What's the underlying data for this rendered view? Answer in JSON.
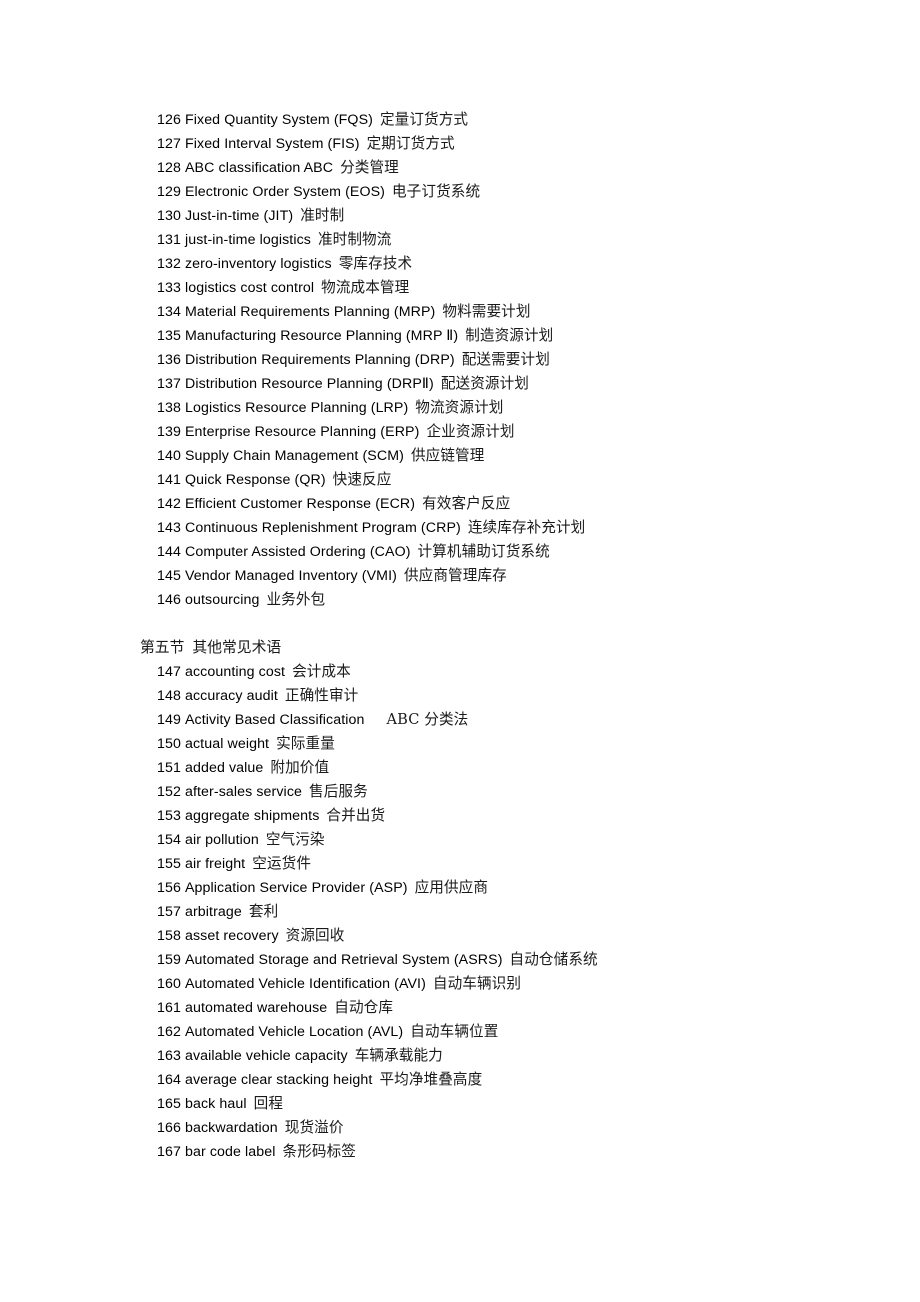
{
  "document": {
    "page_background": "#ffffff",
    "text_color": "#000000",
    "blocks": [
      {
        "type": "entry-list",
        "entries": [
          {
            "num": "126",
            "term": "Fixed Quantity System (FQS)",
            "gloss": "定量订货方式"
          },
          {
            "num": "127",
            "term": "Fixed Interval System (FIS)",
            "gloss": "定期订货方式"
          },
          {
            "num": "128",
            "term": "ABC classification ABC",
            "gloss": "分类管理"
          },
          {
            "num": "129",
            "term": "Electronic Order System (EOS)",
            "gloss": "电子订货系统"
          },
          {
            "num": "130",
            "term": "Just-in-time (JIT)",
            "gloss": "准时制"
          },
          {
            "num": "131",
            "term": "just-in-time logistics",
            "gloss": "准时制物流"
          },
          {
            "num": "132",
            "term": "zero-inventory logistics",
            "gloss": "零库存技术"
          },
          {
            "num": "133",
            "term": "logistics cost control",
            "gloss": "物流成本管理"
          },
          {
            "num": "134",
            "term": "Material Requirements Planning (MRP)",
            "gloss": "物料需要计划"
          },
          {
            "num": "135",
            "term": "Manufacturing Resource Planning (MRP Ⅱ)",
            "gloss": "制造资源计划"
          },
          {
            "num": "136",
            "term": "Distribution Requirements Planning (DRP)",
            "gloss": "配送需要计划"
          },
          {
            "num": "137",
            "term": "Distribution Resource Planning (DRPⅡ)",
            "gloss": "配送资源计划"
          },
          {
            "num": "138",
            "term": "Logistics Resource Planning (LRP)",
            "gloss": "物流资源计划"
          },
          {
            "num": "139",
            "term": "Enterprise Resource Planning (ERP)",
            "gloss": "企业资源计划"
          },
          {
            "num": "140",
            "term": "Supply Chain Management (SCM)",
            "gloss": "供应链管理"
          },
          {
            "num": "141",
            "term": "Quick Response (QR)",
            "gloss": "快速反应"
          },
          {
            "num": "142",
            "term": "Efficient Customer Response (ECR)",
            "gloss": "有效客户反应"
          },
          {
            "num": "143",
            "term": "Continuous Replenishment Program (CRP)",
            "gloss": "连续库存补充计划"
          },
          {
            "num": "144",
            "term": "Computer Assisted Ordering (CAO)",
            "gloss": "计算机辅助订货系统"
          },
          {
            "num": "145",
            "term": "Vendor Managed Inventory (VMI)",
            "gloss": "供应商管理库存"
          },
          {
            "num": "146",
            "term": "outsourcing",
            "gloss": "业务外包"
          }
        ]
      },
      {
        "type": "section-heading",
        "label": "第五节",
        "title": "其他常见术语"
      },
      {
        "type": "entry-list",
        "entries": [
          {
            "num": "147",
            "term": "accounting cost",
            "gloss": "会计成本"
          },
          {
            "num": "148",
            "term": "accuracy audit",
            "gloss": "正确性审计"
          },
          {
            "num": "149",
            "term": "Activity Based Classification",
            "gloss": "ABC 分类法",
            "gap": "wide"
          },
          {
            "num": "150",
            "term": "actual weight",
            "gloss": "实际重量"
          },
          {
            "num": "151",
            "term": "added value",
            "gloss": "附加价值"
          },
          {
            "num": "152",
            "term": "after-sales service",
            "gloss": "售后服务"
          },
          {
            "num": "153",
            "term": "aggregate shipments",
            "gloss": "合并出货"
          },
          {
            "num": "154",
            "term": "air pollution",
            "gloss": "空气污染"
          },
          {
            "num": "155",
            "term": "air freight",
            "gloss": "空运货件"
          },
          {
            "num": "156",
            "term": "Application Service Provider (ASP)",
            "gloss": "应用供应商"
          },
          {
            "num": "157",
            "term": "arbitrage",
            "gloss": "套利"
          },
          {
            "num": "158",
            "term": "asset recovery",
            "gloss": "资源回收"
          },
          {
            "num": "159",
            "term": "Automated Storage and Retrieval System (ASRS)",
            "gloss": "自动仓储系统"
          },
          {
            "num": "160",
            "term": "Automated Vehicle Identification (AVI)",
            "gloss": "自动车辆识别"
          },
          {
            "num": "161",
            "term": "automated warehouse",
            "gloss": "自动仓库"
          },
          {
            "num": "162",
            "term": "Automated Vehicle Location (AVL)",
            "gloss": "自动车辆位置"
          },
          {
            "num": "163",
            "term": "available vehicle capacity",
            "gloss": "车辆承载能力"
          },
          {
            "num": "164",
            "term": "average clear stacking height",
            "gloss": "平均净堆叠高度"
          },
          {
            "num": "165",
            "term": "back haul",
            "gloss": "回程"
          },
          {
            "num": "166",
            "term": "backwardation",
            "gloss": "现货溢价"
          },
          {
            "num": "167",
            "term": "bar code label",
            "gloss": "条形码标签"
          }
        ]
      }
    ]
  }
}
